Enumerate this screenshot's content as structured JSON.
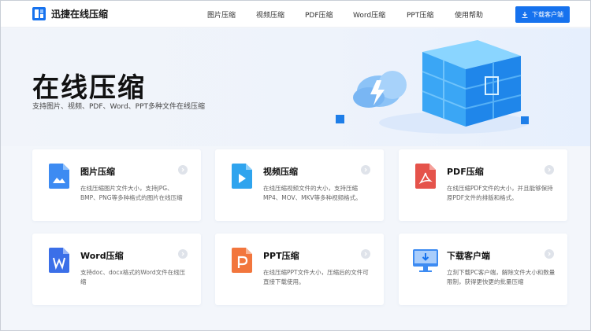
{
  "header": {
    "app_name": "迅捷在线压缩",
    "nav": [
      "图片压缩",
      "视频压缩",
      "PDF压缩",
      "Word压缩",
      "PPT压缩",
      "使用帮助"
    ],
    "download_button": "下载客户端"
  },
  "hero": {
    "title": "在线压缩",
    "subtitle": "支持图片、视频、PDF、Word、PPT多种文件在线压缩"
  },
  "cards": [
    {
      "title": "图片压缩",
      "desc": "在线压缩图片文件大小，支持JPG、BMP、PNG等多种格式的图片在线压缩",
      "icon": "image-file-icon"
    },
    {
      "title": "视频压缩",
      "desc": "在线压缩视频文件的大小，支持压缩MP4、MOV、MKV等多种视频格式。",
      "icon": "video-file-icon"
    },
    {
      "title": "PDF压缩",
      "desc": "在线压缩PDF文件的大小，并且能够保持原PDF文件的排版和格式。",
      "icon": "pdf-file-icon"
    },
    {
      "title": "Word压缩",
      "desc": "支持doc、docx格式的Word文件在线压缩",
      "icon": "word-file-icon"
    },
    {
      "title": "PPT压缩",
      "desc": "在线压缩PPT文件大小，压缩后的文件可直接下载使用。",
      "icon": "ppt-file-icon"
    },
    {
      "title": "下载客户端",
      "desc": "立刻下载PC客户端，解除文件大小和数量限制，获得更快更的批量压缩",
      "icon": "desktop-download-icon"
    }
  ],
  "colors": {
    "brand_blue": "#1672ee",
    "image_icon": "#3d8bf2",
    "video_icon": "#2fa4ee",
    "pdf_icon": "#e5534b",
    "word_icon": "#3b6fe8",
    "ppt_icon": "#f2763d"
  }
}
